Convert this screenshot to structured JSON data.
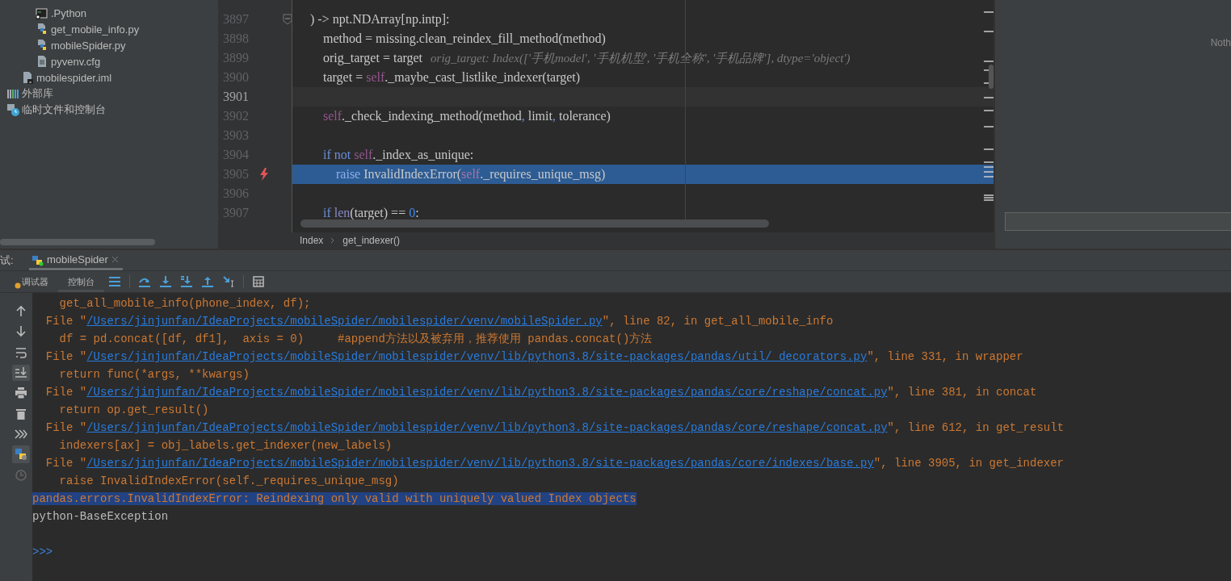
{
  "sidebar": {
    "items": [
      {
        "children": [
          {
            "children": [
              {
                "label": ".Python",
                "kind": "terminal"
              },
              {
                "label": "get_mobile_info.py",
                "kind": "python"
              },
              {
                "label": "mobileSpider.py",
                "kind": "python"
              },
              {
                "label": "pyvenv.cfg",
                "kind": "text"
              }
            ]
          },
          {
            "label": "mobilespider.iml",
            "kind": "module"
          }
        ]
      },
      {
        "label": "外部库",
        "kind": "library"
      },
      {
        "label": "临时文件和控制台",
        "kind": "scratch"
      }
    ]
  },
  "editor": {
    "lines": [
      {
        "number": "3897",
        "kind": "fold_start",
        "segments": [
          {
            "kind": "plain",
            "text": ") -> npt.NDArray[np.intp]:"
          }
        ]
      },
      {
        "number": "3898",
        "kind": "code",
        "segments": [
          {
            "kind": "plain",
            "text": "    method = missing.clean_reindex_fill_method(method)"
          }
        ]
      },
      {
        "number": "3899",
        "kind": "code",
        "segments": [
          {
            "kind": "plain",
            "text": "    orig_target = target"
          },
          {
            "kind": "hint",
            "text": "orig_target: Index(['手机model', '手机机型', '手机全称', '手机品牌'], dtype='object')"
          }
        ]
      },
      {
        "number": "3900",
        "kind": "code",
        "segments": [
          {
            "kind": "plain",
            "text": "    target = "
          },
          {
            "kind": "self",
            "text": "self"
          },
          {
            "kind": "plain",
            "text": "._maybe_cast_listlike_indexer(target)"
          }
        ]
      },
      {
        "number": "3901",
        "kind": "caret"
      },
      {
        "number": "3902",
        "kind": "code",
        "segments": [
          {
            "kind": "self",
            "text": "    self"
          },
          {
            "kind": "plain",
            "text": "._check_indexing_method(method"
          },
          {
            "kind": "keyword",
            "text": ", "
          },
          {
            "kind": "plain",
            "text": "limit"
          },
          {
            "kind": "keyword",
            "text": ", "
          },
          {
            "kind": "plain",
            "text": "tolerance)"
          }
        ]
      },
      {
        "number": "3903",
        "kind": "code"
      },
      {
        "number": "3904",
        "kind": "code",
        "segments": [
          {
            "kind": "keyword",
            "text": "    if not "
          },
          {
            "kind": "self",
            "text": "self"
          },
          {
            "kind": "plain",
            "text": "._index_as_unique:"
          }
        ]
      },
      {
        "number": "3905",
        "kind": "exception_point",
        "segments": [
          {
            "kind": "keyword",
            "text": "        raise "
          },
          {
            "kind": "plain",
            "text": "InvalidIndexError("
          },
          {
            "kind": "self",
            "text": "self"
          },
          {
            "kind": "plain",
            "text": "._requires_unique_msg)"
          }
        ]
      },
      {
        "number": "3906",
        "kind": "code"
      },
      {
        "number": "3907",
        "kind": "code",
        "segments": [
          {
            "kind": "keyword",
            "text": "    if "
          },
          {
            "kind": "builtin",
            "text": "len"
          },
          {
            "kind": "plain",
            "text": "(target) == "
          },
          {
            "kind": "number",
            "text": "0"
          },
          {
            "kind": "plain",
            "text": ":"
          }
        ]
      }
    ],
    "breadcrumb": [
      "Index",
      "get_indexer()"
    ]
  },
  "right_panel": {
    "text": "Noth"
  },
  "debug": {
    "label": "试:",
    "tabs": [
      {
        "label": "mobileSpider",
        "selected": true
      }
    ],
    "subtabs": [
      {
        "label": "调试器",
        "selected": false
      },
      {
        "label": "控制台",
        "selected": true
      }
    ]
  },
  "console": {
    "lines": [
      {
        "kind": "trace",
        "selected": false,
        "segments": [
          {
            "kind": "text",
            "text": "    get_all_mobile_info(phone_index, df);"
          }
        ]
      },
      {
        "kind": "trace",
        "selected": false,
        "segments": [
          {
            "kind": "text",
            "text": "  File \""
          },
          {
            "kind": "link",
            "text": "/Users/jinjunfan/IdeaProjects/mobileSpider/mobilespider/venv/mobileSpider.py"
          },
          {
            "kind": "text",
            "text": "\", line 82, in get_all_mobile_info"
          }
        ]
      },
      {
        "kind": "trace",
        "selected": false,
        "segments": [
          {
            "kind": "text",
            "text": "    df = pd.concat([df, df1],  axis = 0)     #append方法以及被弃用，推荐使用 pandas.concat()方法"
          }
        ]
      },
      {
        "kind": "trace",
        "selected": false,
        "segments": [
          {
            "kind": "text",
            "text": "  File \""
          },
          {
            "kind": "link",
            "text": "/Users/jinjunfan/IdeaProjects/mobileSpider/mobilespider/venv/lib/python3.8/site-packages/pandas/util/_decorators.py"
          },
          {
            "kind": "text",
            "text": "\", line 331, in wrapper"
          }
        ]
      },
      {
        "kind": "trace",
        "selected": false,
        "segments": [
          {
            "kind": "text",
            "text": "    return func(*args, **kwargs)"
          }
        ]
      },
      {
        "kind": "trace",
        "selected": false,
        "segments": [
          {
            "kind": "text",
            "text": "  File \""
          },
          {
            "kind": "link",
            "text": "/Users/jinjunfan/IdeaProjects/mobileSpider/mobilespider/venv/lib/python3.8/site-packages/pandas/core/reshape/concat.py"
          },
          {
            "kind": "text",
            "text": "\", line 381, in concat"
          }
        ]
      },
      {
        "kind": "trace",
        "selected": false,
        "segments": [
          {
            "kind": "text",
            "text": "    return op.get_result()"
          }
        ]
      },
      {
        "kind": "trace",
        "selected": false,
        "segments": [
          {
            "kind": "text",
            "text": "  File \""
          },
          {
            "kind": "link",
            "text": "/Users/jinjunfan/IdeaProjects/mobileSpider/mobilespider/venv/lib/python3.8/site-packages/pandas/core/reshape/concat.py"
          },
          {
            "kind": "text",
            "text": "\", line 612, in get_result"
          }
        ]
      },
      {
        "kind": "trace",
        "selected": false,
        "segments": [
          {
            "kind": "text",
            "text": "    indexers[ax] = obj_labels.get_indexer(new_labels)"
          }
        ]
      },
      {
        "kind": "trace",
        "selected": false,
        "segments": [
          {
            "kind": "text",
            "text": "  File \""
          },
          {
            "kind": "link",
            "text": "/Users/jinjunfan/IdeaProjects/mobileSpider/mobilespider/venv/lib/python3.8/site-packages/pandas/core/indexes/base.py"
          },
          {
            "kind": "text",
            "text": "\", line 3905, in get_indexer"
          }
        ]
      },
      {
        "kind": "trace",
        "selected": false,
        "segments": [
          {
            "kind": "text",
            "text": "    raise InvalidIndexError(self._requires_unique_msg)"
          }
        ]
      },
      {
        "kind": "trace",
        "selected": true,
        "segments": [
          {
            "kind": "text",
            "text": "pandas.errors.InvalidIndexError: Reindexing only valid with uniquely valued Index objects"
          }
        ]
      },
      {
        "kind": "trace",
        "selected": false,
        "segments": [
          {
            "kind": "output",
            "text": "python-BaseException"
          }
        ]
      },
      {
        "kind": "prompt",
        "selected": false,
        "segments": [
          {
            "kind": "prompt",
            "text": ">>>"
          }
        ]
      }
    ]
  }
}
